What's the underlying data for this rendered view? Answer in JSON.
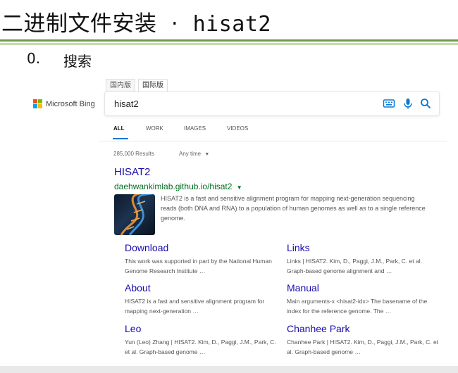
{
  "slide": {
    "title_cn": "二进制文件安装",
    "title_sep": "·",
    "title_code": "hisat2",
    "step_number": "0.",
    "step_label": "搜索"
  },
  "colors": {
    "rule_dark": "#6f9a4a",
    "rule_light": "#c6dcae",
    "link": "#1a0dab",
    "url": "#006d21",
    "accent": "#0a7ad6"
  },
  "bing": {
    "region_tabs": [
      "国内版",
      "国际版"
    ],
    "active_region_tab": "国际版",
    "logo_text": "Microsoft Bing",
    "search_query": "hisat2",
    "icons": [
      "keyboard-icon",
      "microphone-icon",
      "search-icon"
    ],
    "nav": [
      {
        "label": "ALL",
        "active": true
      },
      {
        "label": "WORK",
        "active": false
      },
      {
        "label": "IMAGES",
        "active": false
      },
      {
        "label": "VIDEOS",
        "active": false
      }
    ],
    "results_count": "285,000 Results",
    "time_filter": "Any time",
    "result": {
      "title": "HISAT2",
      "url": "daehwankimlab.github.io/hisat2",
      "snippet": "HISAT2 is a fast and sensitive alignment program for mapping next-generation sequencing reads (both DNA and RNA) to a population of human genomes as well as to a single reference genome."
    },
    "deep_links": [
      {
        "title": "Download",
        "text": "This work was supported in part by the National Human Genome Research Institute …"
      },
      {
        "title": "Links",
        "text": "Links | HISAT2. Kim, D., Paggi, J.M., Park, C. et al. Graph-based genome alignment and …"
      },
      {
        "title": "About",
        "text": "HISAT2 is a fast and sensitive alignment program for mapping next-generation …"
      },
      {
        "title": "Manual",
        "text": "Main arguments-x <hisat2-idx> The basename of the index for the reference genome. The …"
      },
      {
        "title": "Leo",
        "text": "Yun (Leo) Zhang | HISAT2. Kim, D., Paggi, J.M., Park, C. et al. Graph-based genome …"
      },
      {
        "title": "Chanhee Park",
        "text": "Chanhee Park | HISAT2. Kim, D., Paggi, J.M., Park, C. et al. Graph-based genome …"
      }
    ]
  }
}
